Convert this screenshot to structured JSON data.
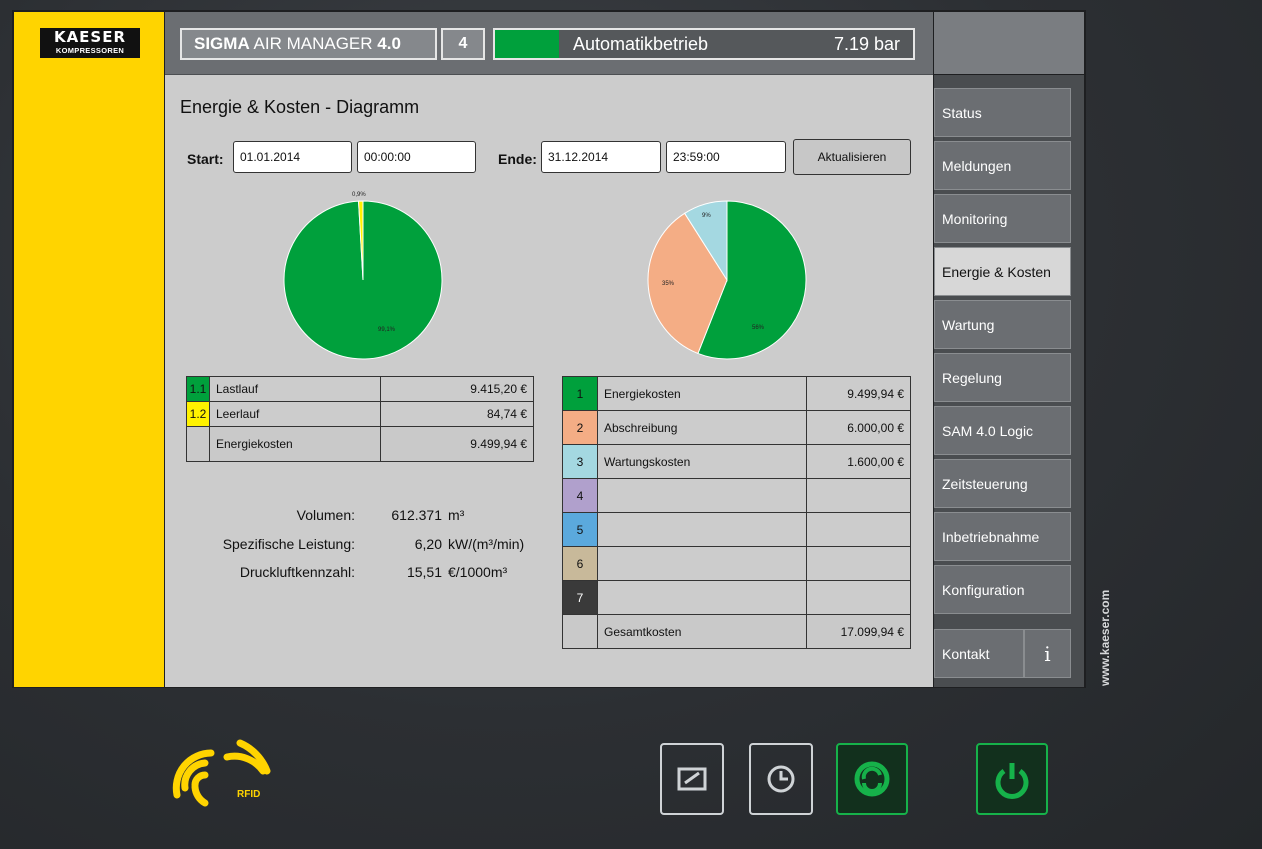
{
  "brand": {
    "line1": "KAESER",
    "line2": "KOMPRESSOREN"
  },
  "header": {
    "app_title_bold": "SIGMA",
    "app_title_rest": "AIR MANAGER",
    "app_title_version": "4.0",
    "station_number": "4",
    "mode": "Automatikbetrieb",
    "pressure": "7.19 bar",
    "status_color": "#00a03c"
  },
  "page": {
    "title": "Energie & Kosten - Diagramm",
    "start_label": "Start:",
    "start_date": "01.01.2014",
    "start_time": "00:00:00",
    "end_label": "Ende:",
    "end_date": "31.12.2014",
    "end_time": "23:59:00",
    "refresh_label": "Aktualisieren"
  },
  "chart_data": [
    {
      "type": "pie",
      "slices": [
        {
          "label": "99,1%",
          "value": 99.1,
          "color": "#00a03c"
        },
        {
          "label": "0,9%",
          "value": 0.9,
          "color": "#fff200"
        }
      ]
    },
    {
      "type": "pie",
      "slices": [
        {
          "label": "56%",
          "value": 56,
          "color": "#00a03c"
        },
        {
          "label": "35%",
          "value": 35,
          "color": "#f4ad85"
        },
        {
          "label": "9%",
          "value": 9,
          "color": "#a4d8e1"
        }
      ]
    }
  ],
  "energy_table": {
    "rows": [
      {
        "id": "1.1",
        "name": "Lastlauf",
        "value": "9.415,20 €",
        "color": "#00a03c"
      },
      {
        "id": "1.2",
        "name": "Leerlauf",
        "value": "84,74 €",
        "color": "#fff200"
      }
    ],
    "total_label": "Energiekosten",
    "total_value": "9.499,94 €"
  },
  "cost_table": {
    "rows": [
      {
        "id": "1",
        "name": "Energiekosten",
        "value": "9.499,94 €",
        "color": "#00a03c"
      },
      {
        "id": "2",
        "name": "Abschreibung",
        "value": "6.000,00 €",
        "color": "#f4ad85"
      },
      {
        "id": "3",
        "name": "Wartungskosten",
        "value": "1.600,00 €",
        "color": "#a4d8e1"
      },
      {
        "id": "4",
        "name": "",
        "value": "",
        "color": "#b0a0cc"
      },
      {
        "id": "5",
        "name": "",
        "value": "",
        "color": "#5ba9dd"
      },
      {
        "id": "6",
        "name": "",
        "value": "",
        "color": "#c8b99a"
      },
      {
        "id": "7",
        "name": "",
        "value": "",
        "color": "#3a3a3a"
      }
    ],
    "total_label": "Gesamtkosten",
    "total_value": "17.099,94 €"
  },
  "stats": [
    {
      "label": "Volumen:",
      "value": "612.371",
      "unit": "m³"
    },
    {
      "label": "Spezifische Leistung:",
      "value": "6,20",
      "unit": "kW/(m³/min)"
    },
    {
      "label": "Druckluftkennzahl:",
      "value": "15,51",
      "unit": "€/1000m³"
    }
  ],
  "nav": {
    "items": [
      "Status",
      "Meldungen",
      "Monitoring",
      "Energie & Kosten",
      "Wartung",
      "Regelung",
      "SAM 4.0 Logic",
      "Zeitsteuerung",
      "Inbetriebnahme",
      "Konfiguration",
      "Kontakt"
    ],
    "active": "Energie & Kosten",
    "info": "i"
  },
  "bezel": {
    "website": "www.kaeser.com",
    "rfid_label": "RFID",
    "buttons": [
      "edit-icon",
      "clock-icon",
      "auto-icon",
      "power-icon"
    ]
  }
}
